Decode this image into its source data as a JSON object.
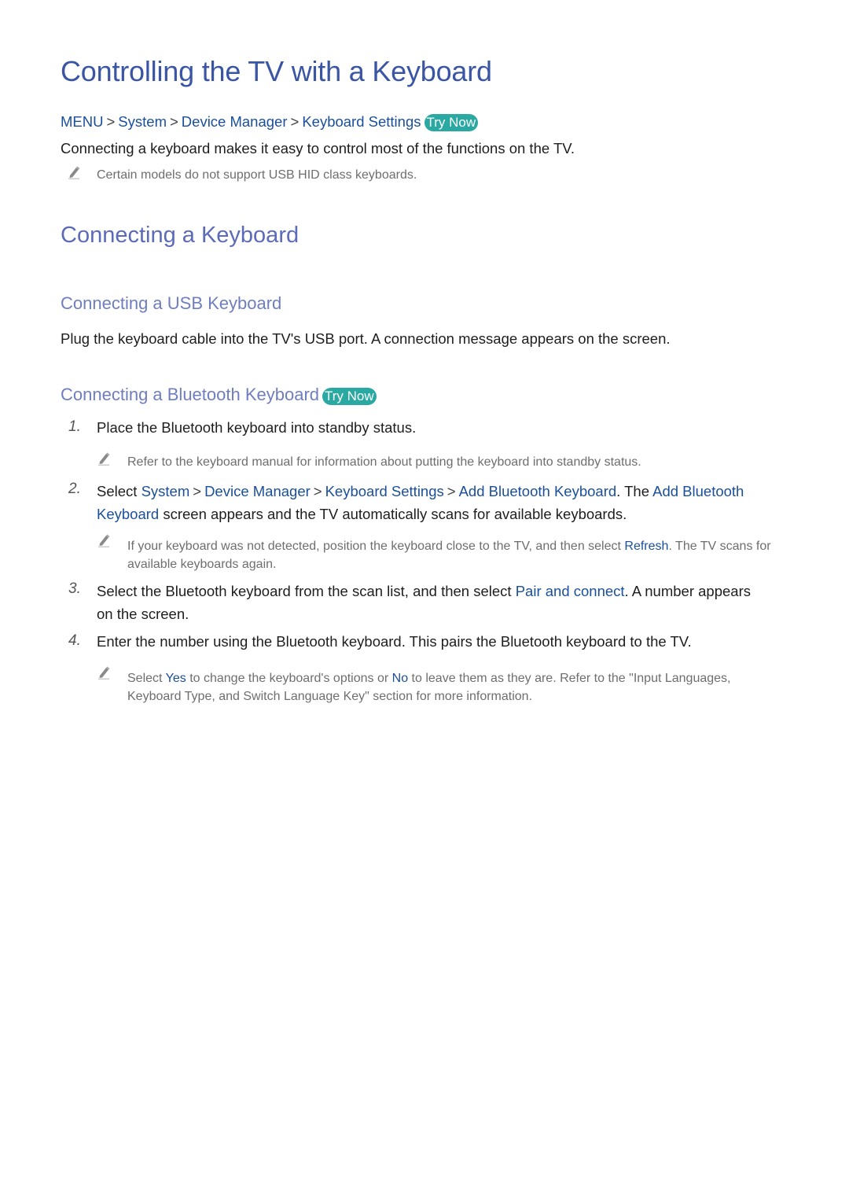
{
  "title": "Controlling the TV with a Keyboard",
  "breadcrumb": {
    "items": [
      "MENU",
      "System",
      "Device Manager",
      "Keyboard Settings"
    ],
    "try_now": "Try Now"
  },
  "intro": "Connecting a keyboard makes it easy to control most of the functions on the TV.",
  "intro_note": "Certain models do not support USB HID class keyboards.",
  "section": {
    "title": "Connecting a Keyboard",
    "usb": {
      "title": "Connecting a USB Keyboard",
      "text": "Plug the keyboard cable into the TV's USB port. A connection message appears on the screen."
    },
    "bluetooth": {
      "title": "Connecting a Bluetooth Keyboard",
      "try_now": "Try Now",
      "steps": [
        {
          "num": "1.",
          "text": "Place the Bluetooth keyboard into standby status.",
          "note": "Refer to the keyboard manual for information about putting the keyboard into standby status."
        },
        {
          "num": "2.",
          "pre": "Select",
          "path": [
            "System",
            "Device Manager",
            "Keyboard Settings",
            "Add Bluetooth Keyboard"
          ],
          "mid": ". The",
          "link2": "Add Bluetooth Keyboard",
          "post": "screen appears and the TV automatically scans for available keyboards.",
          "note_pre": "If your keyboard was not detected, position the keyboard close to the TV, and then select",
          "note_link": "Refresh",
          "note_post": ". The TV scans for available keyboards again."
        },
        {
          "num": "3.",
          "pre": "Select the Bluetooth keyboard from the scan list, and then select",
          "link": "Pair and connect",
          "post": ". A number appears on the screen."
        },
        {
          "num": "4.",
          "text": "Enter the number using the Bluetooth keyboard. This pairs the Bluetooth keyboard to the TV.",
          "note_pre": "Select",
          "note_yes": "Yes",
          "note_mid": "to change the keyboard's options or",
          "note_no": "No",
          "note_post": "to leave them as they are. Refer to the \"Input Languages, Keyboard Type, and Switch Language Key\" section for more information."
        }
      ]
    }
  }
}
